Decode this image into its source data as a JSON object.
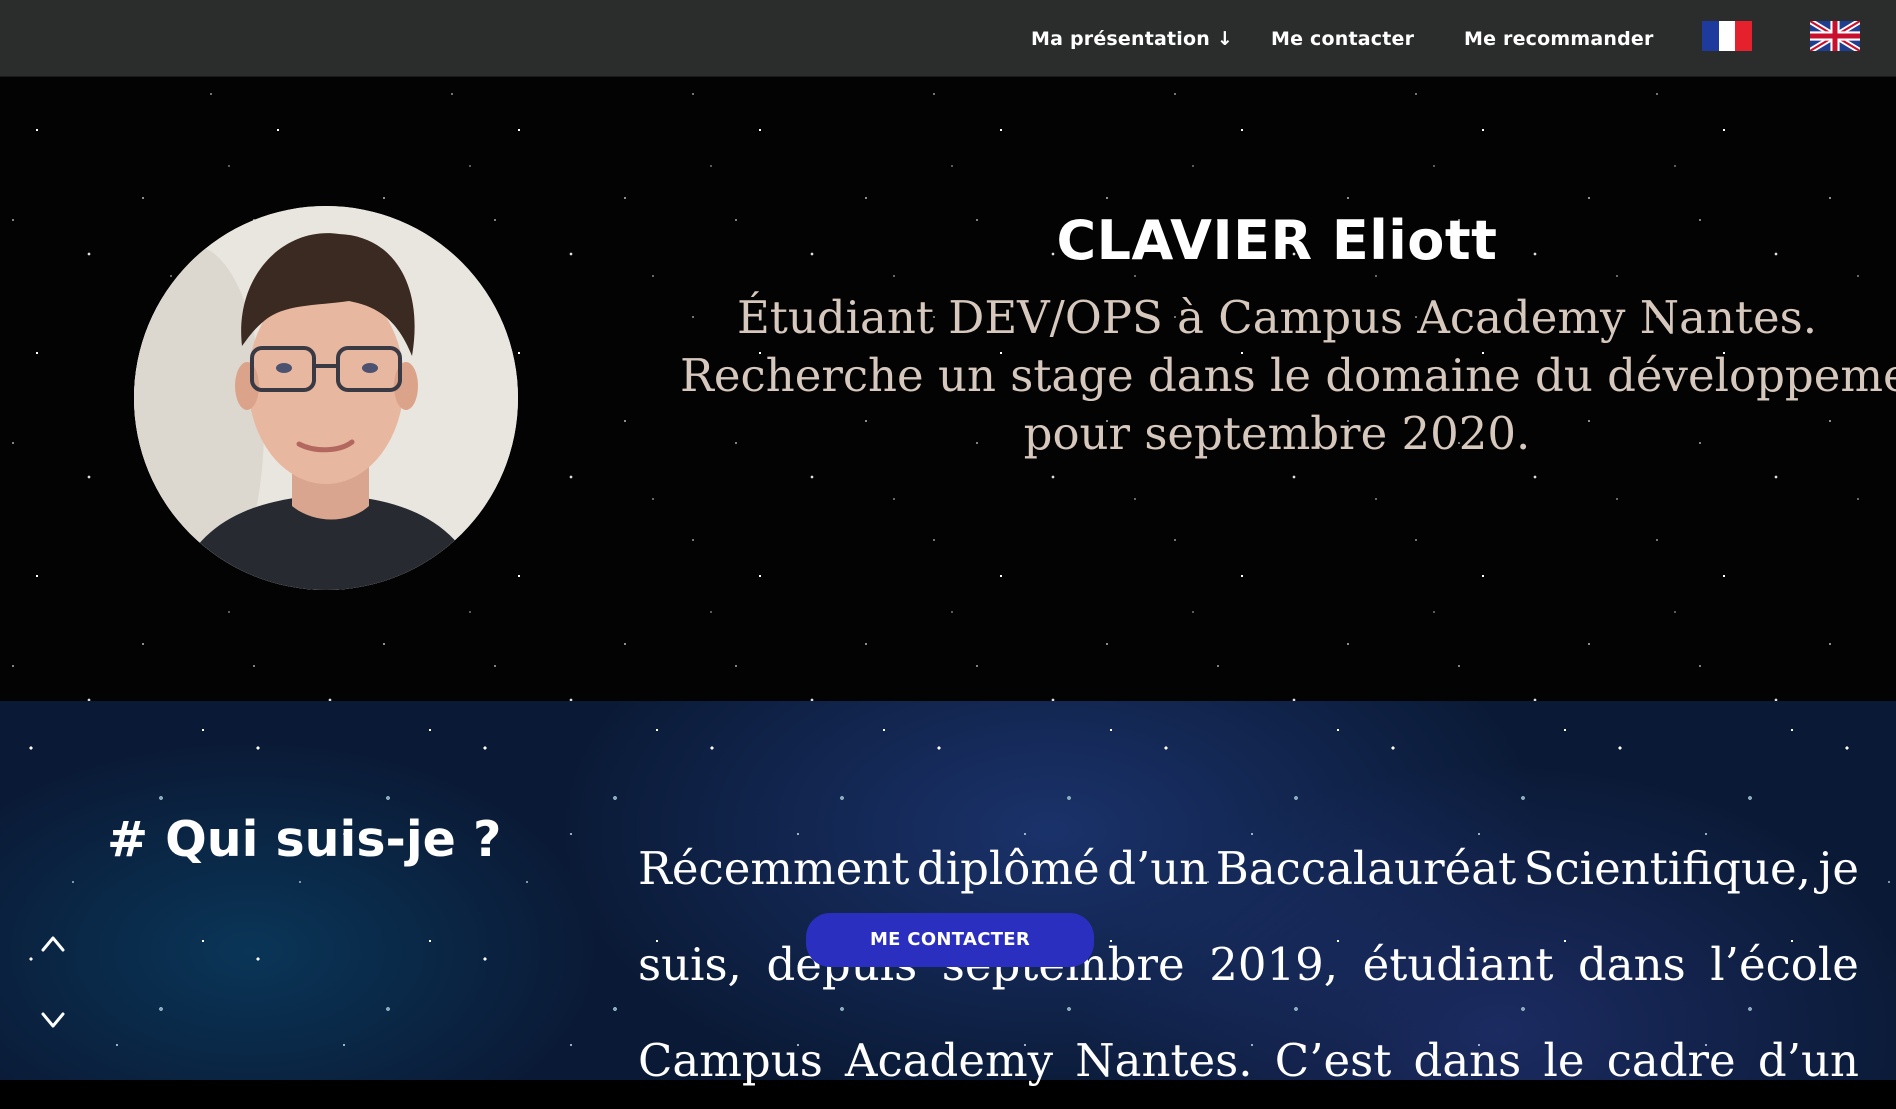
{
  "nav": {
    "presentation_label": "Ma présentation ↓",
    "contact_label": "Me contacter",
    "recommend_label": "Me recommander",
    "flags": [
      "fr-flag-icon",
      "uk-flag-icon"
    ]
  },
  "hero": {
    "name": "CLAVIER Eliott",
    "description_lines": [
      "Étudiant DEV/OPS à Campus Academy Nantes.",
      "Recherche un stage dans le domaine du développement",
      "pour septembre 2020."
    ]
  },
  "about": {
    "title": "# Qui suis-je ?",
    "text_lines": [
      [
        "Récemment",
        "diplômé",
        "d’un",
        "Baccalauréat",
        "Scientifique,",
        "je"
      ],
      [
        "suis,",
        "depuis",
        "septembre",
        "2019,",
        "étudiant",
        "dans",
        "l’école"
      ],
      [
        "Campus",
        "Academy",
        "Nantes.",
        "C’est",
        "dans",
        "le",
        "cadre",
        "d’un"
      ]
    ],
    "contact_button_label": "ME CONTACTER",
    "scroll_up_icon": "chevron-up-icon",
    "scroll_down_icon": "chevron-down-icon"
  },
  "colors": {
    "navbar_bg": "#2b2c2c",
    "description_text": "#d6c8bd",
    "contact_button": "#2b2fbf"
  }
}
